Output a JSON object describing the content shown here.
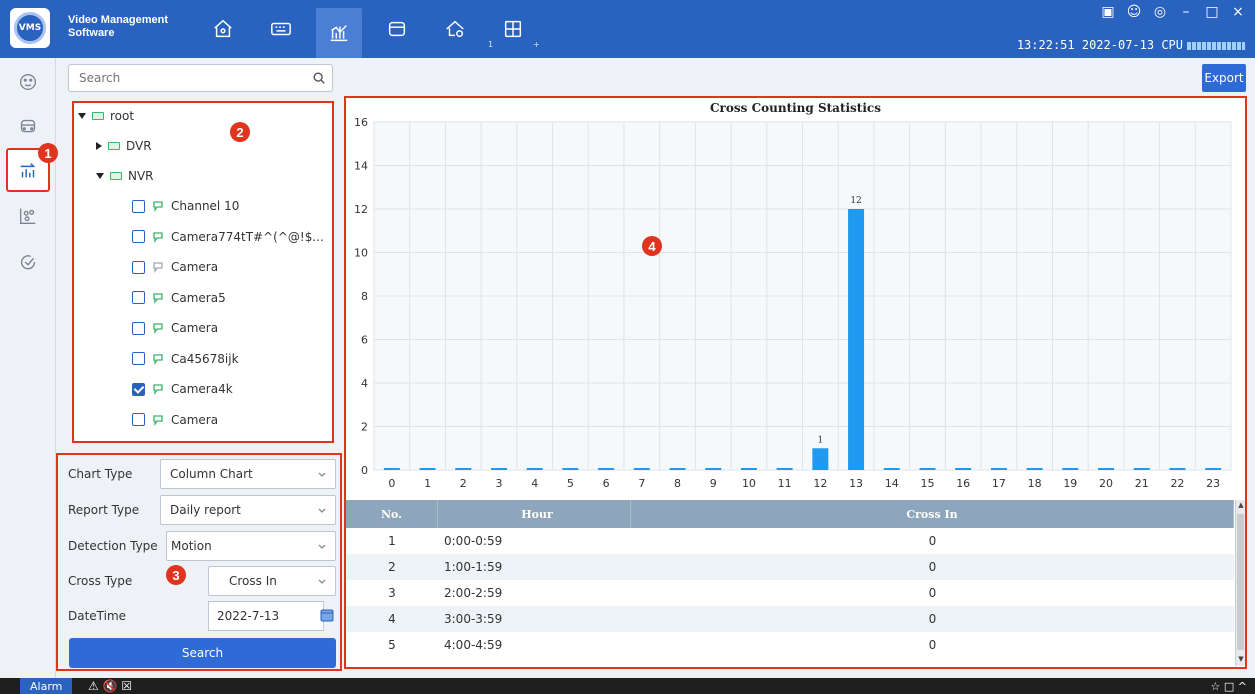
{
  "app": {
    "title_line1": "Video Management",
    "title_line2": "Software",
    "logo_text": "VMS",
    "clock": "13:22:51 2022-07-13 CPU",
    "window_controls": [
      "▣",
      "☺",
      "◎",
      "–",
      "□",
      "×"
    ],
    "nav_sub_1": "1",
    "nav_sub_plus": "+"
  },
  "badges": {
    "b1": "1",
    "b2": "2",
    "b3": "3",
    "b4": "4"
  },
  "search": {
    "placeholder": "Search"
  },
  "tree": {
    "root": "root",
    "dvr": "DVR",
    "nvr": "NVR",
    "channels": [
      {
        "label": "Channel 10",
        "checked": false,
        "online": true
      },
      {
        "label": "Camera774tT#^(^@!$...",
        "checked": false,
        "online": true
      },
      {
        "label": "Camera",
        "checked": false,
        "online": false
      },
      {
        "label": "Camera5",
        "checked": false,
        "online": true
      },
      {
        "label": "Camera",
        "checked": false,
        "online": true
      },
      {
        "label": "Ca45678ijk",
        "checked": false,
        "online": true
      },
      {
        "label": "Camera4k",
        "checked": true,
        "online": true
      },
      {
        "label": "Camera",
        "checked": false,
        "online": true
      }
    ]
  },
  "options": {
    "chart_type_label": "Chart Type",
    "chart_type_value": "Column Chart",
    "report_type_label": "Report Type",
    "report_type_value": "Daily report",
    "detection_type_label": "Detection Type",
    "detection_type_value": "Motion",
    "cross_type_label": "Cross Type",
    "cross_type_value": "Cross In",
    "datetime_label": "DateTime",
    "datetime_value": "2022-7-13",
    "search_button": "Search"
  },
  "export_button": "Export",
  "colors": {
    "accent": "#2a62c0",
    "bar": "#1e9bf0",
    "highlight": "#e0341f"
  },
  "chart_data": {
    "type": "bar",
    "title": "Cross Counting Statistics",
    "categories": [
      "0",
      "1",
      "2",
      "3",
      "4",
      "5",
      "6",
      "7",
      "8",
      "9",
      "10",
      "11",
      "12",
      "13",
      "14",
      "15",
      "16",
      "17",
      "18",
      "19",
      "20",
      "21",
      "22",
      "23"
    ],
    "values": [
      0,
      0,
      0,
      0,
      0,
      0,
      0,
      0,
      0,
      0,
      0,
      0,
      1,
      12,
      0,
      0,
      0,
      0,
      0,
      0,
      0,
      0,
      0,
      0
    ],
    "data_labels_shown_for_nonzero": true,
    "ylim": [
      0,
      16
    ],
    "yticks": [
      0,
      2,
      4,
      6,
      8,
      10,
      12,
      14,
      16
    ],
    "xlabel": "",
    "ylabel": "",
    "grid": true
  },
  "table": {
    "headers": [
      "No.",
      "Hour",
      "Cross In"
    ],
    "rows": [
      [
        "1",
        "0:00-0:59",
        "0"
      ],
      [
        "2",
        "1:00-1:59",
        "0"
      ],
      [
        "3",
        "2:00-2:59",
        "0"
      ],
      [
        "4",
        "3:00-3:59",
        "0"
      ],
      [
        "5",
        "4:00-4:59",
        "0"
      ]
    ]
  },
  "bottom": {
    "alarm": "Alarm",
    "icons": "⚠ 🔇 ☒",
    "right_icons": "☆ □ ^"
  }
}
